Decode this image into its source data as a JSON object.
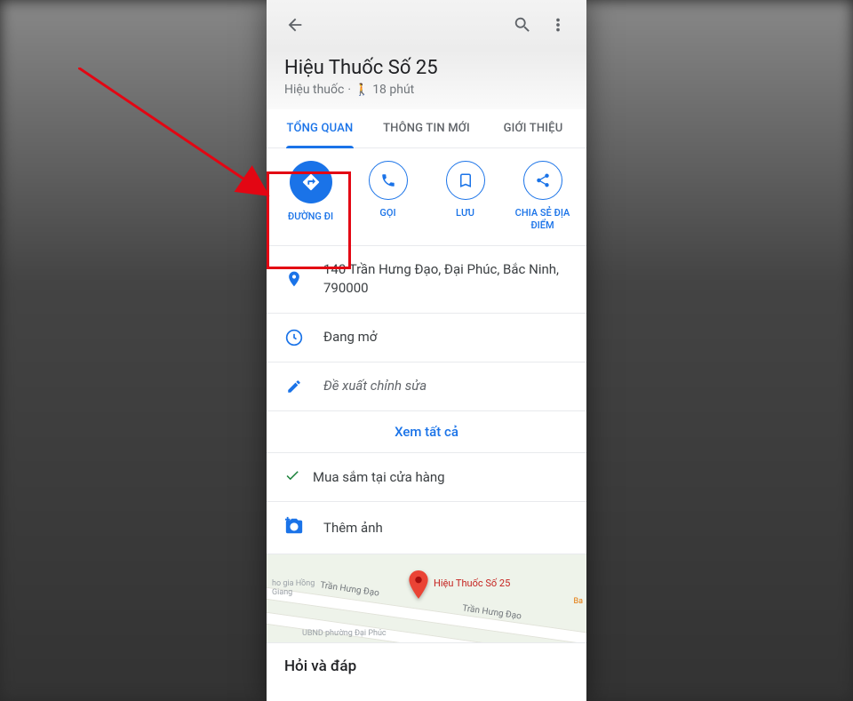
{
  "header": {
    "title": "Hiệu Thuốc Số 25",
    "category": "Hiệu thuốc",
    "walk_time": "18 phút"
  },
  "tabs": {
    "overview": "TỔNG QUAN",
    "updates": "THÔNG TIN MỚI",
    "about": "GIỚI THIỆU"
  },
  "actions": {
    "directions": "ĐƯỜNG ĐI",
    "call": "GỌI",
    "save": "LƯU",
    "share": "CHIA SẺ ĐỊA ĐIỂM"
  },
  "details": {
    "address": "140 Trần Hưng Đạo, Đại Phúc, Bắc Ninh, 790000",
    "hours_status": "Đang mở",
    "suggest_edit": "Đề xuất chỉnh sửa",
    "see_all": "Xem tất cả",
    "in_store_shopping": "Mua sắm tại cửa hàng",
    "add_photo": "Thêm ảnh"
  },
  "map": {
    "pin_label": "Hiệu Thuốc Số 25",
    "road_name": "Trần Hưng Đạo",
    "poi1": "ho gia Hồng Giang",
    "poi2": "UBND phường Đại Phúc",
    "poi3": "Ba"
  },
  "qa": {
    "title": "Hỏi và đáp"
  }
}
